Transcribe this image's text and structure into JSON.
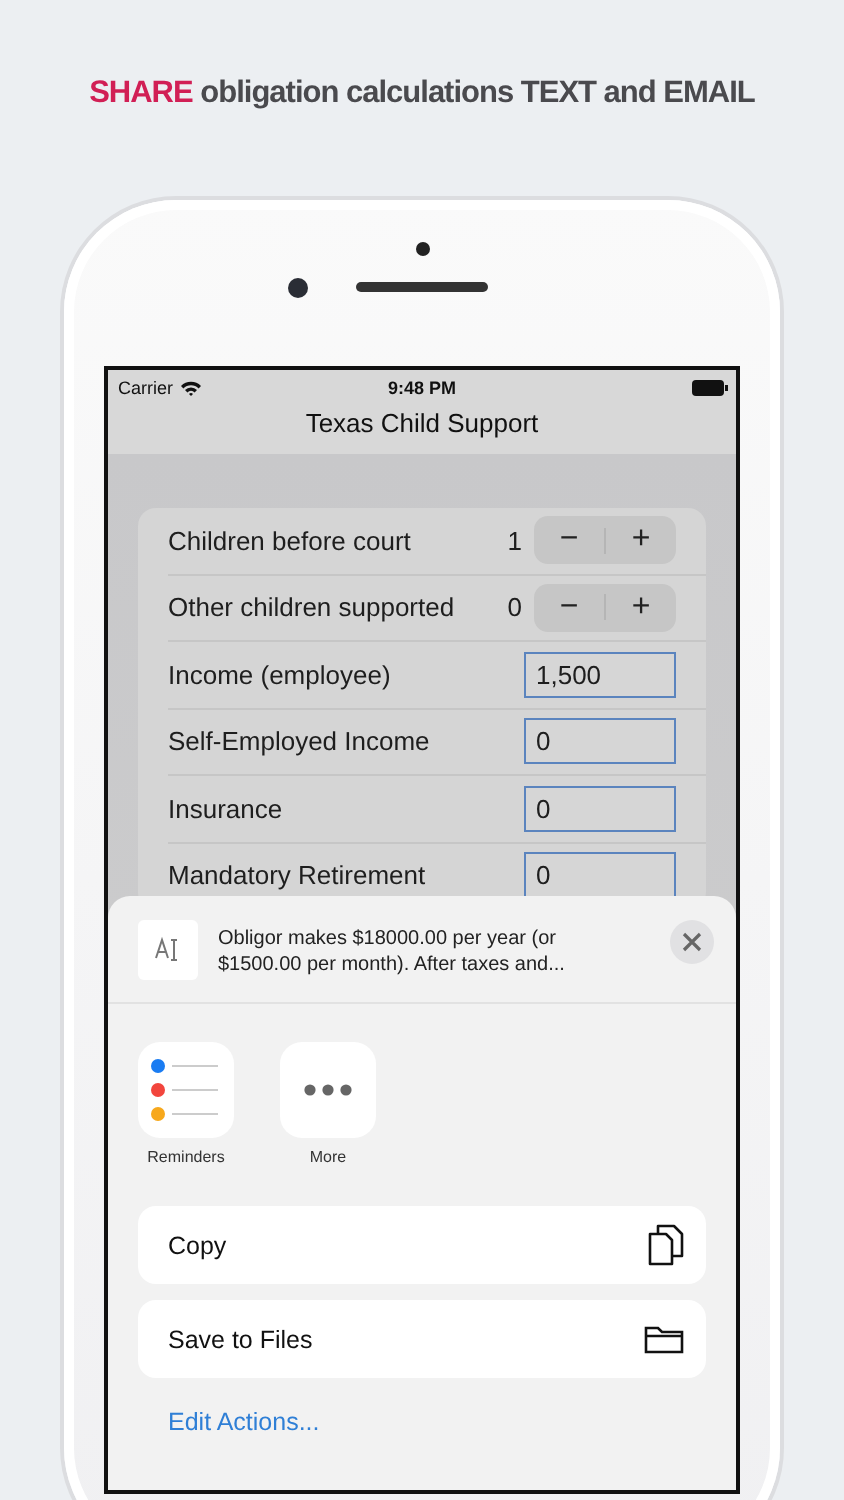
{
  "headline": {
    "highlight": "SHARE",
    "text": "obligation calculations TEXT and EMAIL"
  },
  "status_bar": {
    "carrier": "Carrier",
    "time": "9:48 PM"
  },
  "nav": {
    "title": "Texas Child Support"
  },
  "form": {
    "rows": [
      {
        "kind": "stepper",
        "label": "Children before court",
        "value": "1",
        "minus": "−",
        "plus": "+"
      },
      {
        "kind": "stepper",
        "label": "Other children supported",
        "value": "0",
        "minus": "−",
        "plus": "+"
      },
      {
        "kind": "input",
        "label": "Income (employee)",
        "value": "1,500"
      },
      {
        "kind": "input",
        "label": "Self-Employed Income",
        "value": "0"
      },
      {
        "kind": "input",
        "label": "Insurance",
        "value": "0"
      },
      {
        "kind": "input",
        "label": "Mandatory Retirement",
        "value": "0"
      }
    ]
  },
  "share_sheet": {
    "preview": "Obligor makes $18000.00 per year (or $1500.00 per month). After taxes and...",
    "apps": [
      {
        "kind": "reminders",
        "label": "Reminders"
      },
      {
        "kind": "more",
        "label": "More"
      }
    ],
    "actions": [
      {
        "kind": "copy",
        "label": "Copy"
      },
      {
        "kind": "files",
        "label": "Save to Files"
      }
    ],
    "edit_actions": "Edit Actions..."
  }
}
